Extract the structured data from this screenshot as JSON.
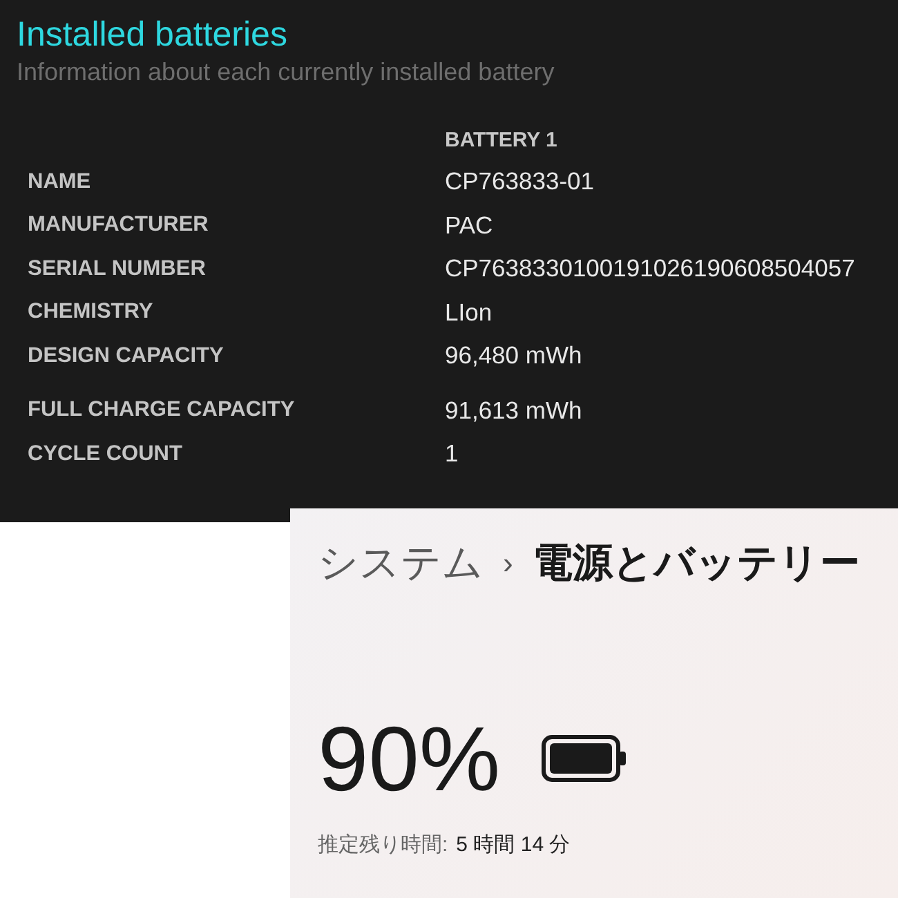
{
  "report": {
    "title": "Installed batteries",
    "subtitle": "Information about each currently installed battery",
    "column_header": "BATTERY 1",
    "groups": [
      [
        {
          "label": "NAME",
          "value": "CP763833-01"
        },
        {
          "label": "MANUFACTURER",
          "value": "PAC"
        },
        {
          "label": "SERIAL NUMBER",
          "value": "CP7638330100191026190608504057"
        },
        {
          "label": "CHEMISTRY",
          "value": "LIon"
        },
        {
          "label": "DESIGN CAPACITY",
          "value": "96,480 mWh"
        }
      ],
      [
        {
          "label": "FULL CHARGE CAPACITY",
          "value": "91,613 mWh"
        },
        {
          "label": "CYCLE COUNT",
          "value": "1"
        }
      ]
    ]
  },
  "settings": {
    "breadcrumb": [
      "システム",
      "電源とバッテリー"
    ],
    "separator": "›",
    "percent": "90%",
    "estimate_label": "推定残り時間:",
    "estimate_value": "5 時間 14 分"
  }
}
